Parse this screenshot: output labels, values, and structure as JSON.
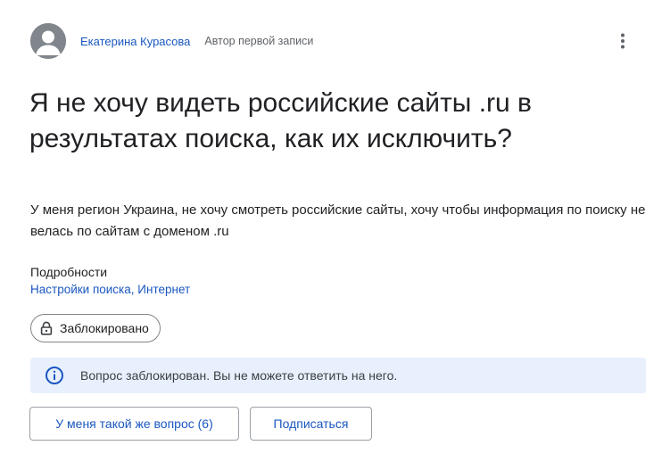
{
  "author": {
    "name": "Екатерина Курасова",
    "role": "Автор первой записи"
  },
  "question": {
    "title": "Я не хочу видеть российские сайты .ru в результатах поиска, как их исключить?",
    "body": "У меня регион Украина, не хочу смотреть российские сайты, хочу чтобы информация по поиску не велась по сайтам с доменом .ru"
  },
  "details": {
    "label": "Подробности",
    "link_1": "Настройки поиска",
    "separator": ", ",
    "link_2": "Интернет"
  },
  "status": {
    "chip_label": "Заблокировано",
    "banner_text": "Вопрос заблокирован. Вы не можете ответить на него."
  },
  "actions": {
    "same_question_label": "У меня такой же вопрос (6)",
    "subscribe_label": "Подписаться"
  },
  "icons": {
    "avatar": "person-avatar-icon",
    "more": "more-vert-icon",
    "lock": "lock-icon",
    "info": "info-icon"
  },
  "colors": {
    "link": "#1a57c0",
    "banner_bg": "#e8f0fe",
    "info_icon": "#1a57c0",
    "avatar_bg": "#80868b"
  }
}
